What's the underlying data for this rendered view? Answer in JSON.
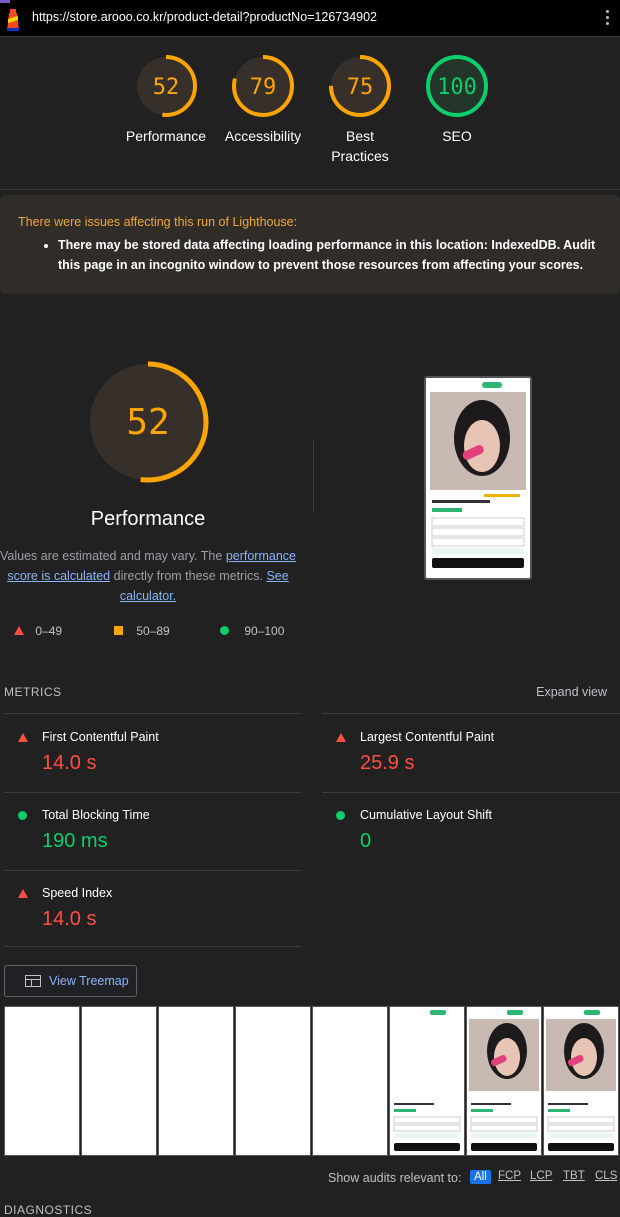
{
  "browser": {
    "url": "https://store.arooo.co.kr/product-detail?productNo=126734902"
  },
  "summary_gauges": [
    {
      "score": "52",
      "label_lines": [
        "Performance"
      ],
      "color": "#ffa400"
    },
    {
      "score": "79",
      "label_lines": [
        "Accessibility"
      ],
      "color": "#ffa400"
    },
    {
      "score": "75",
      "label_lines": [
        "Best",
        "Practices"
      ],
      "color": "#ffa400"
    },
    {
      "score": "100",
      "label_lines": [
        "SEO"
      ],
      "color": "#0cce6b"
    }
  ],
  "warning": {
    "title": "There were issues affecting this run of Lighthouse:",
    "items": [
      "There may be stored data affecting loading performance in this location: IndexedDB. Audit this page in an incognito window to prevent those resources from affecting your scores."
    ]
  },
  "performance": {
    "score": "52",
    "title": "Performance",
    "desc_before": "Values are estimated and may vary. The ",
    "desc_link": "performance score is calculated",
    "desc_middle": " directly from these metrics. ",
    "desc_link2": "See calculator."
  },
  "legend": [
    "0–49",
    "50–89",
    "90–100"
  ],
  "metrics": {
    "heading": "METRICS",
    "expand": "Expand view",
    "items": [
      {
        "title": "First Contentful Paint",
        "value": "14.0 s",
        "status": "red"
      },
      {
        "title": "Largest Contentful Paint",
        "value": "25.9 s",
        "status": "red"
      },
      {
        "title": "Total Blocking Time",
        "value": "190 ms",
        "status": "green"
      },
      {
        "title": "Cumulative Layout Shift",
        "value": "0",
        "status": "green"
      },
      {
        "title": "Speed Index",
        "value": "14.0 s",
        "status": "red"
      }
    ]
  },
  "treemap": {
    "label": "View Treemap"
  },
  "audits_filter": {
    "label": "Show audits relevant to:",
    "chips": [
      "All",
      "FCP",
      "LCP",
      "TBT",
      "CLS"
    ]
  },
  "diagnostics": {
    "heading": "DIAGNOSTICS"
  },
  "colors": {
    "fail": "#ff4e42",
    "average": "#ffa400",
    "pass": "#0cce6b"
  }
}
